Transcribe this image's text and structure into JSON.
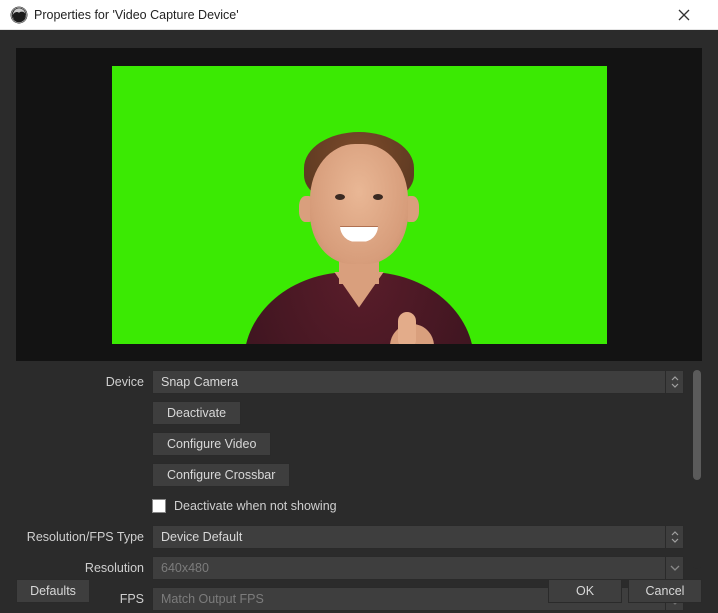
{
  "window": {
    "title": "Properties for 'Video Capture Device'"
  },
  "form": {
    "device_label": "Device",
    "device_value": "Snap Camera",
    "deactivate_button": "Deactivate",
    "configure_video_button": "Configure Video",
    "configure_crossbar_button": "Configure Crossbar",
    "deactivate_when_not_showing_label": "Deactivate when not showing",
    "deactivate_when_not_showing_checked": false,
    "resolution_fps_type_label": "Resolution/FPS Type",
    "resolution_fps_type_value": "Device Default",
    "resolution_label": "Resolution",
    "resolution_value": "640x480",
    "fps_label": "FPS",
    "fps_value": "Match Output FPS"
  },
  "footer": {
    "defaults": "Defaults",
    "ok": "OK",
    "cancel": "Cancel"
  }
}
